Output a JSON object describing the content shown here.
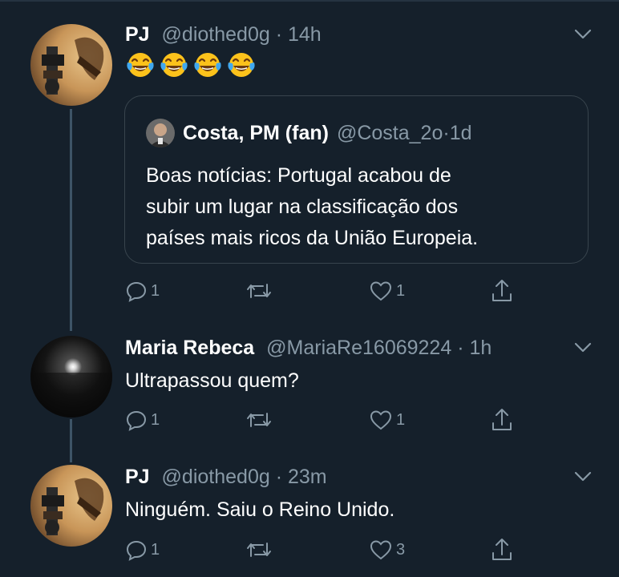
{
  "tweets": [
    {
      "name": "PJ",
      "handle": "@diothed0g",
      "time": "14h",
      "emoji": "face-with-tears-of-joy",
      "emoji_count": 4,
      "quote": {
        "name": "Costa, PM (fan)",
        "handle": "@Costa_2o",
        "time": "1d",
        "lines": [
          "Boas notícias: Portugal acabou de",
          "subir um lugar na classificação dos",
          "países mais ricos da União Europeia."
        ]
      },
      "actions": {
        "reply": "1",
        "retweet": "",
        "like": "1"
      }
    },
    {
      "name": "Maria Rebeca",
      "handle": "@MariaRe16069224",
      "time": "1h",
      "text": "Ultrapassou quem?",
      "actions": {
        "reply": "1",
        "retweet": "",
        "like": "1"
      }
    },
    {
      "name": "PJ",
      "handle": "@diothed0g",
      "time": "23m",
      "text": "Ninguém. Saiu o Reino Unido.",
      "actions": {
        "reply": "1",
        "retweet": "",
        "like": "3"
      }
    }
  ],
  "separator": " · ",
  "icons": {
    "reply": "reply-icon",
    "retweet": "retweet-icon",
    "like": "like-icon",
    "share": "share-icon",
    "more": "chevron-down-icon"
  },
  "colors": {
    "background": "#15202b",
    "muted": "#8899a6",
    "border": "#38444d",
    "thread_line": "#3d5466"
  }
}
